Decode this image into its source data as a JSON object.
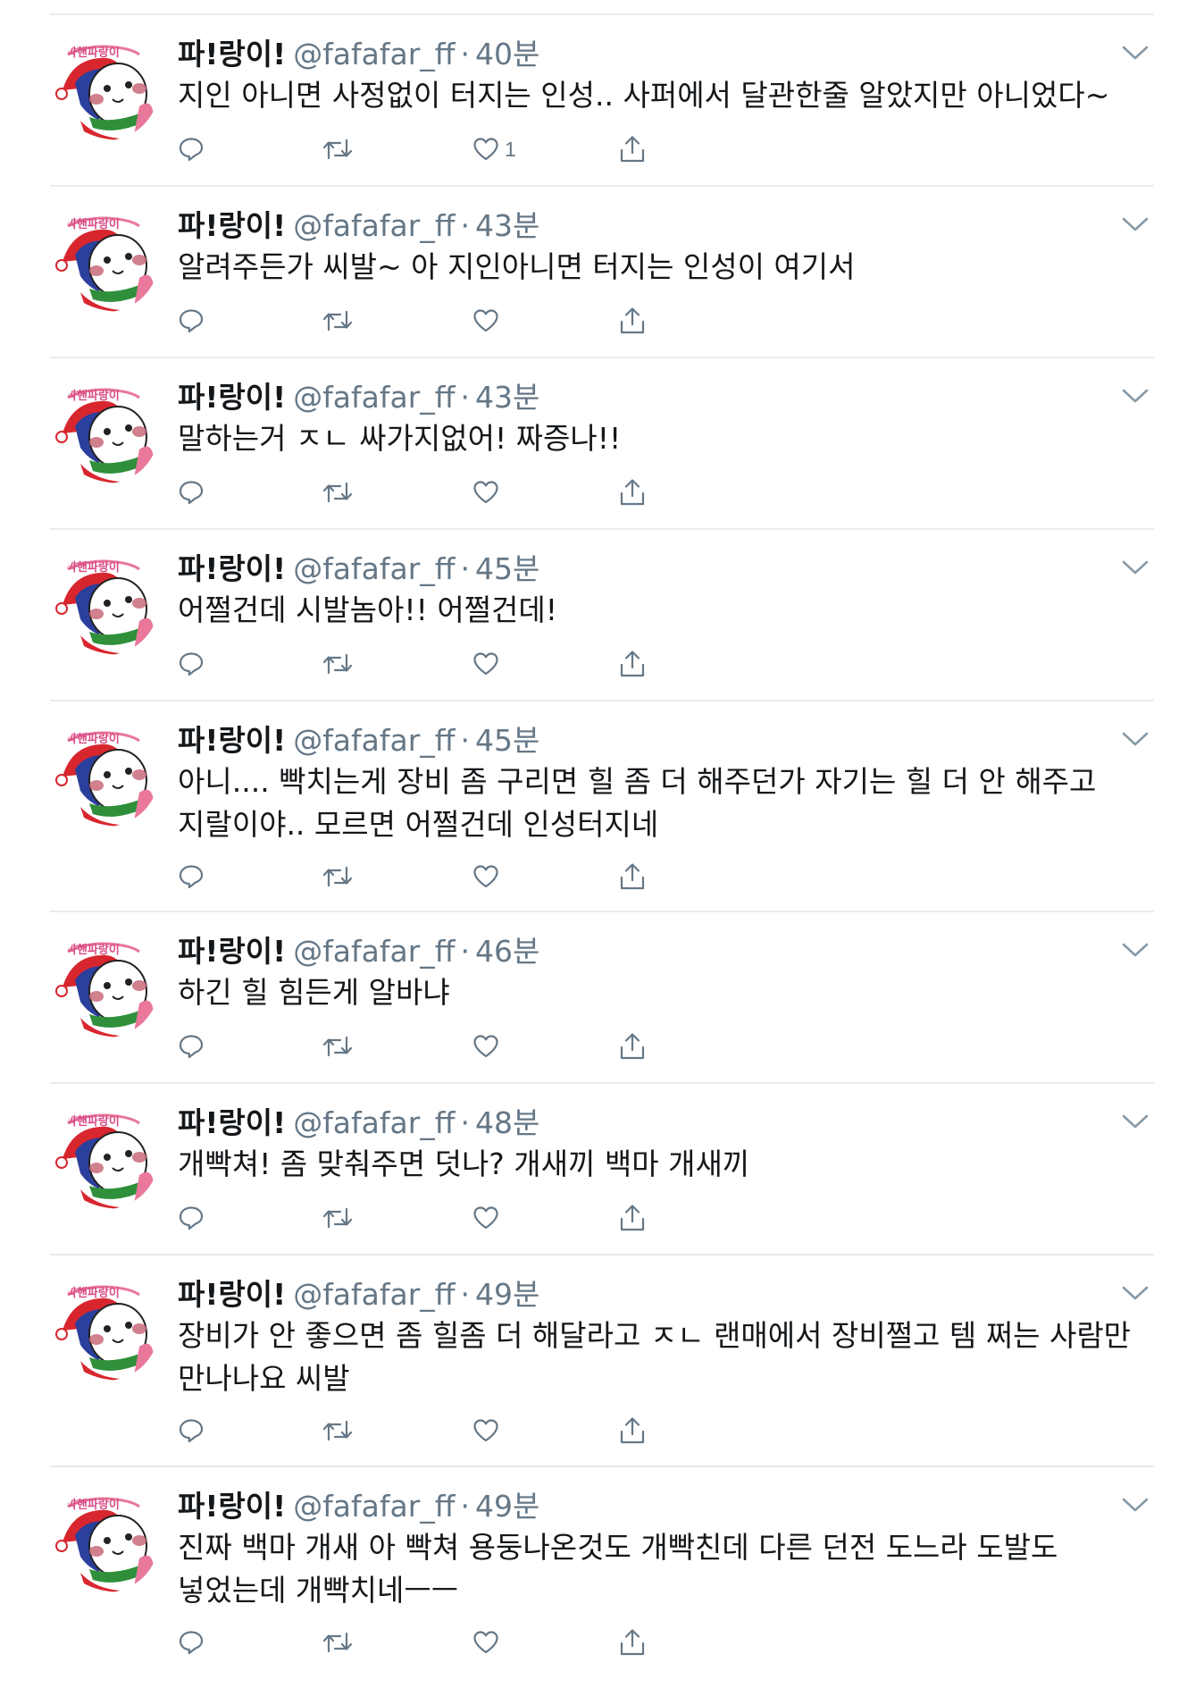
{
  "user": {
    "name": "파!랑이!",
    "handle": "@fafafar_ff",
    "avatar_caption": "꺅핸파랑이"
  },
  "colors": {
    "text": "#14171a",
    "secondary": "#657786",
    "divider": "#e6ecf0",
    "avatar_red": "#d8262f",
    "avatar_blue": "#2b3f9c",
    "avatar_green": "#2f8f3a",
    "avatar_pink": "#e9789a"
  },
  "tweets": [
    {
      "time": "40분",
      "text": "지인 아니면 사정없이 터지는 인성.. 사퍼에서 달관한줄 알았지만 아니었다~",
      "reply_icon": "reply-icon",
      "retweet_icon": "retweet-icon",
      "like_icon": "heart-icon",
      "like_count": "1",
      "share_icon": "share-icon"
    },
    {
      "time": "43분",
      "text": "알려주든가 씨발~ 아 지인아니면 터지는 인성이 여기서",
      "like_count": ""
    },
    {
      "time": "43분",
      "text": "말하는거 ㅈㄴ 싸가지없어! 짜증나!!",
      "like_count": ""
    },
    {
      "time": "45분",
      "text": "어쩔건데 시발놈아!! 어쩔건데!",
      "like_count": ""
    },
    {
      "time": "45분",
      "text": "아니.... 빡치는게 장비 좀 구리면 힐 좀 더 해주던가 자기는 힐 더 안 해주고 지랄이야.. 모르면 어쩔건데 인성터지네",
      "like_count": ""
    },
    {
      "time": "46분",
      "text": "하긴 힐 힘든게 알바냐",
      "like_count": ""
    },
    {
      "time": "48분",
      "text": "개빡쳐! 좀 맞춰주면 덧나? 개새끼 백마 개새끼",
      "like_count": ""
    },
    {
      "time": "49분",
      "text": "장비가 안 좋으면 좀 힐좀 더 해달라고 ㅈㄴ 랜매에서 장비쩔고 템 쩌는 사람만 만나나요 씨발",
      "like_count": ""
    },
    {
      "time": "49분",
      "text": "진짜 백마 개새 아 빡쳐 용둥나온것도 개빡친데 다른 던전 도느라 도발도 넣었는데 개빡치네ㅡㅡ",
      "like_count": ""
    }
  ]
}
